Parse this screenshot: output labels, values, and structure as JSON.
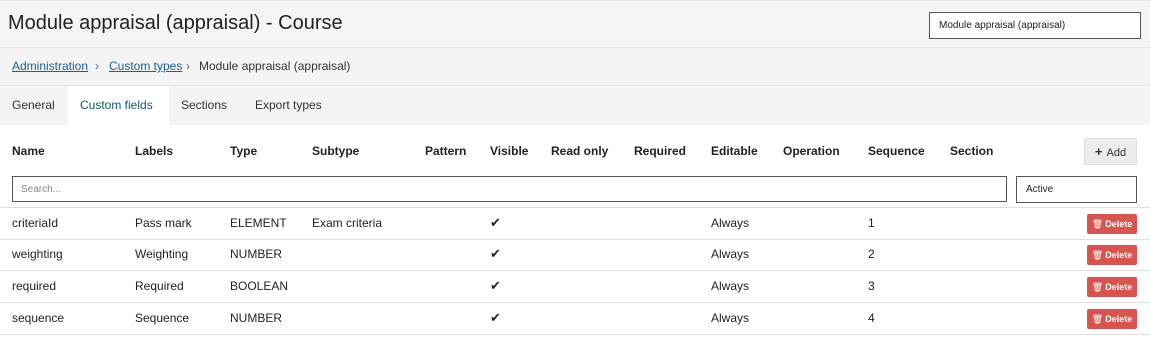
{
  "header": {
    "title": "Module appraisal (appraisal) - Course",
    "record_selector": "Module appraisal (appraisal)"
  },
  "breadcrumb": {
    "items": [
      "Administration",
      "Custom types"
    ],
    "current": "Module appraisal (appraisal)"
  },
  "tabs": [
    "General",
    "Custom fields",
    "Sections",
    "Export types"
  ],
  "active_tab": "Custom fields",
  "table": {
    "columns": [
      "Name",
      "Labels",
      "Type",
      "Subtype",
      "Pattern",
      "Visible",
      "Read only",
      "Required",
      "Editable",
      "Operation",
      "Sequence",
      "Section"
    ],
    "add_label": "Add",
    "search_placeholder": "Search...",
    "filter_value": "Active",
    "delete_label": "Delete",
    "rows": [
      {
        "name": "criteriaId",
        "label": "Pass mark",
        "type": "ELEMENT",
        "subtype": "Exam criteria",
        "visible": true,
        "editable": "Always",
        "sequence": "1"
      },
      {
        "name": "weighting",
        "label": "Weighting",
        "type": "NUMBER",
        "subtype": "",
        "visible": true,
        "editable": "Always",
        "sequence": "2"
      },
      {
        "name": "required",
        "label": "Required",
        "type": "BOOLEAN",
        "subtype": "",
        "visible": true,
        "editable": "Always",
        "sequence": "3"
      },
      {
        "name": "sequence",
        "label": "Sequence",
        "type": "NUMBER",
        "subtype": "",
        "visible": true,
        "editable": "Always",
        "sequence": "4"
      }
    ]
  },
  "colors": {
    "link": "#1a5f9c",
    "active_tab_text": "#0e5a6d",
    "delete_button": "#d9534f"
  },
  "icons": {
    "check": "checkmark-icon",
    "add": "plus-icon",
    "delete": "trash-icon",
    "breadcrumb_separator": "chevron-right-icon"
  }
}
